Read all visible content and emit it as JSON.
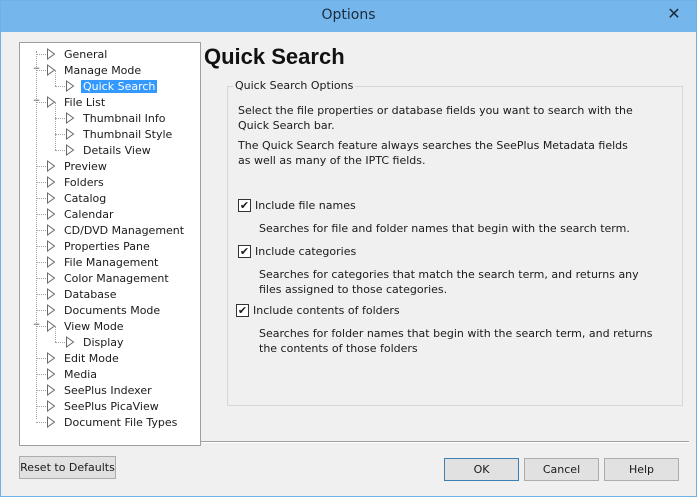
{
  "window": {
    "title": "Options",
    "close_glyph": "✕"
  },
  "tree": {
    "items": [
      {
        "label": "General",
        "level": 0,
        "expander": ""
      },
      {
        "label": "Manage Mode",
        "level": 0,
        "expander": "−"
      },
      {
        "label": "Quick Search",
        "level": 1,
        "expander": "",
        "selected": true
      },
      {
        "label": "File List",
        "level": 0,
        "expander": "−"
      },
      {
        "label": "Thumbnail Info",
        "level": 1,
        "expander": ""
      },
      {
        "label": "Thumbnail Style",
        "level": 1,
        "expander": ""
      },
      {
        "label": "Details View",
        "level": 1,
        "expander": ""
      },
      {
        "label": "Preview",
        "level": 0,
        "expander": ""
      },
      {
        "label": "Folders",
        "level": 0,
        "expander": ""
      },
      {
        "label": "Catalog",
        "level": 0,
        "expander": ""
      },
      {
        "label": "Calendar",
        "level": 0,
        "expander": ""
      },
      {
        "label": "CD/DVD Management",
        "level": 0,
        "expander": ""
      },
      {
        "label": "Properties Pane",
        "level": 0,
        "expander": ""
      },
      {
        "label": "File Management",
        "level": 0,
        "expander": ""
      },
      {
        "label": "Color Management",
        "level": 0,
        "expander": ""
      },
      {
        "label": "Database",
        "level": 0,
        "expander": ""
      },
      {
        "label": "Documents Mode",
        "level": 0,
        "expander": ""
      },
      {
        "label": "View Mode",
        "level": 0,
        "expander": "−"
      },
      {
        "label": "Display",
        "level": 1,
        "expander": ""
      },
      {
        "label": "Edit Mode",
        "level": 0,
        "expander": ""
      },
      {
        "label": "Media",
        "level": 0,
        "expander": ""
      },
      {
        "label": "SeePlus Indexer",
        "level": 0,
        "expander": ""
      },
      {
        "label": "SeePlus PicaView",
        "level": 0,
        "expander": ""
      },
      {
        "label": "Document File Types",
        "level": 0,
        "expander": ""
      }
    ]
  },
  "panel": {
    "heading": "Quick Search",
    "group_title": "Quick Search Options",
    "intro1": "Select the file properties or database fields you want to search with the Quick Search bar.",
    "intro2": "The Quick Search feature always searches the SeePlus Metadata fields as well as many of the IPTC fields.",
    "options": [
      {
        "label": "Include file names",
        "checked": true,
        "check_glyph": "✔",
        "description": "Searches for file and folder names that begin with the search term."
      },
      {
        "label": "Include categories",
        "checked": true,
        "check_glyph": "✔",
        "description": "Searches for categories that match the search term, and returns any files assigned to those categories."
      },
      {
        "label": "Include contents of folders",
        "checked": true,
        "check_glyph": "✔",
        "description": "Searches for folder names that begin with the search term, and returns the contents of those folders"
      }
    ]
  },
  "buttons": {
    "reset": "Reset to Defaults",
    "ok": "OK",
    "cancel": "Cancel",
    "help": "Help"
  }
}
